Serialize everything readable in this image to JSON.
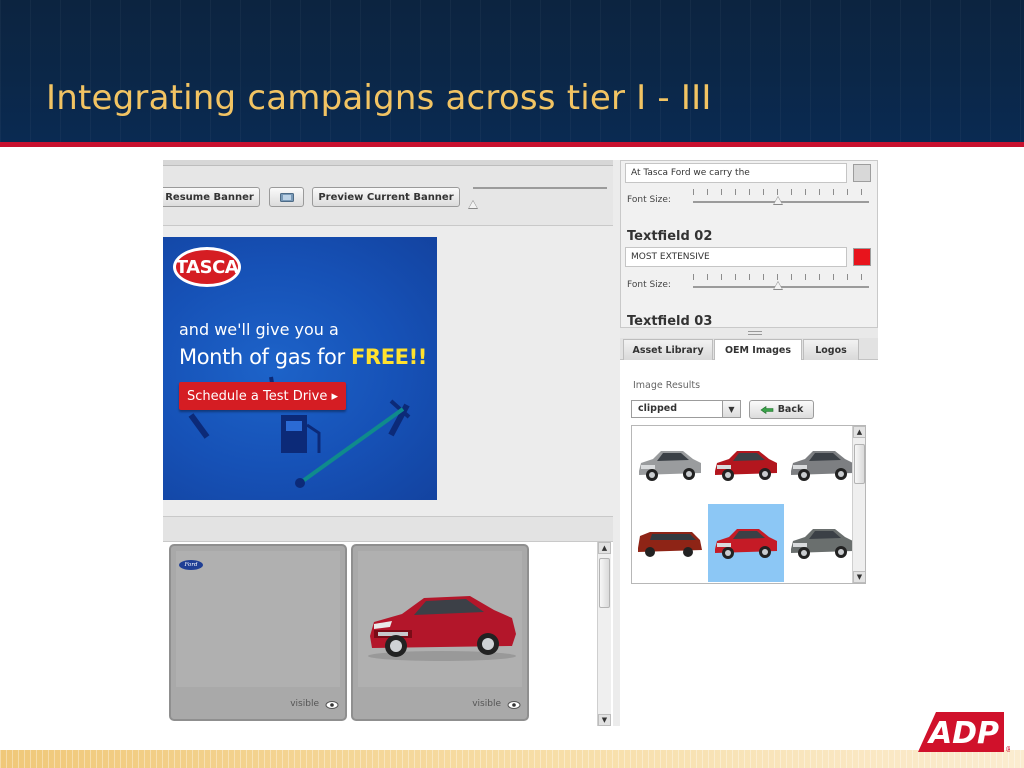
{
  "slide": {
    "title": "Integrating campaigns across tier I - III",
    "logo_text": "ADP",
    "registered_mark": "®"
  },
  "toolbar": {
    "resume_label": "Resume Banner",
    "preview_label": "Preview Current Banner"
  },
  "banner": {
    "brand": "TASCA",
    "line1": "and we'll give you a",
    "line2_prefix": "Month of gas for ",
    "line2_highlight": "FREE!!",
    "cta": "Schedule a Test Drive ▸",
    "colors": {
      "background": "#1651b6",
      "accent": "#d51d23",
      "highlight": "#ffe12e"
    }
  },
  "cards": [
    {
      "brand_badge": "Ford",
      "visible_label": "visible"
    },
    {
      "visible_label": "visible"
    }
  ],
  "properties": {
    "textfield1_value": "At Tasca Ford we carry the",
    "font_size_label": "Font Size:",
    "textfield2_heading": "Textfield 02",
    "textfield2_value": "MOST EXTENSIVE",
    "textfield2_color": "#e8141c",
    "textfield3_heading": "Textfield 03"
  },
  "tabs": [
    {
      "label": "Asset Library",
      "active": false
    },
    {
      "label": "OEM Images",
      "active": true
    },
    {
      "label": "Logos",
      "active": false
    }
  ],
  "image_results": {
    "label": "Image Results",
    "filter_value": "clipped",
    "back_label": "Back",
    "thumbnails": [
      {
        "color": "#9a9c9e",
        "selected": false
      },
      {
        "color": "#b3161e",
        "selected": false
      },
      {
        "color": "#7d7f82",
        "selected": false
      },
      {
        "color": "#8e2416",
        "selected": false
      },
      {
        "color": "#c51b26",
        "selected": true
      },
      {
        "color": "#6a6f6e",
        "selected": false
      }
    ]
  }
}
